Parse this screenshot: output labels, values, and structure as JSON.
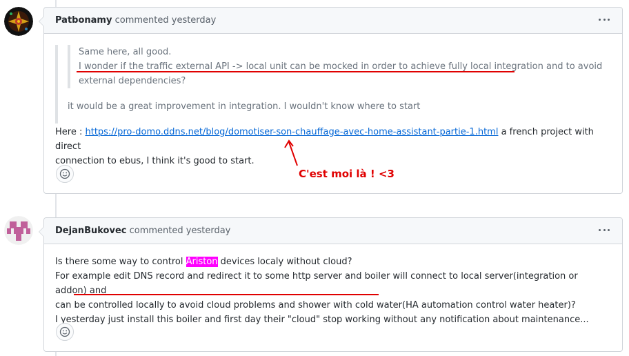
{
  "comments": [
    {
      "author": "Patbonamy",
      "action": "commented",
      "time": "yesterday",
      "quote_line1": "Same here, all good.",
      "quote_line2_a": "I wonder if the traffic external API -> local unit can be mocked in order to achieve fully local integration",
      "quote_line2_b": " and to avoid",
      "quote_line3": "external dependencies?",
      "quote_reply": "it would be a great improvement in integration. I wouldn't know where to start",
      "here_prefix": "Here : ",
      "link": "https://pro-domo.ddns.net/blog/domotiser-son-chauffage-avec-home-assistant-partie-1.html",
      "link_suffix": " a french project with direct",
      "line2": "connection to ebus, I think it's good to start."
    },
    {
      "author": "DejanBukovec",
      "action": "commented",
      "time": "yesterday",
      "line1_a": "Is there some way to control ",
      "line1_hl": "Ariston",
      "line1_b": " devices localy without cloud?",
      "line2": "For example edit DNS record and redirect it to some http server and boiler will connect to local server(integration or addon) and",
      "line3_a": "can ",
      "line3_ul": "be controlled locally to avoid cloud problems and shower with cold water",
      "line3_b": "(HA automation control water heater)?",
      "line4": "I yesterday just install this boiler and first day their \"cloud\" stop working without any notification about maintenance..."
    }
  ],
  "annotation": "C'est moi là !  <3",
  "colors": {
    "link": "#0366d6",
    "annotation": "#e00000",
    "highlight": "#ff00ff"
  },
  "icons": [
    "kebab-menu-icon",
    "smiley-icon",
    "arrow-icon"
  ]
}
